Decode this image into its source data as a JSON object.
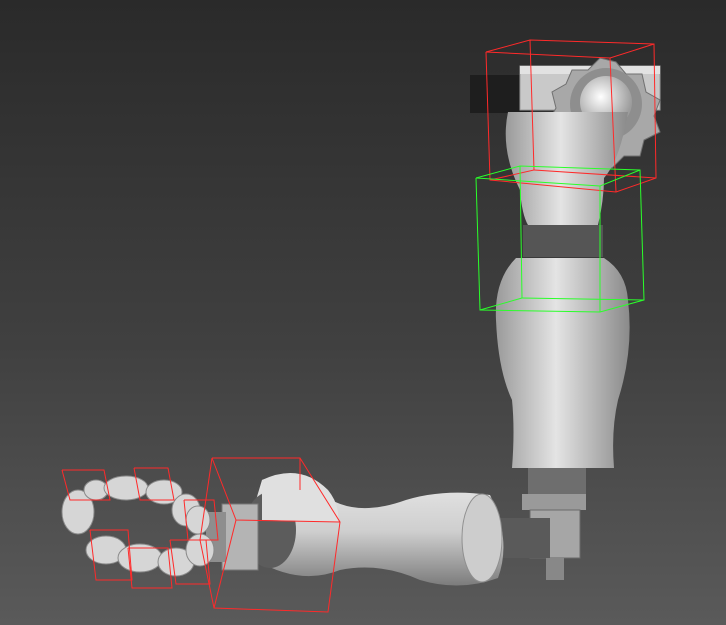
{
  "viewport": {
    "background_top": "#2a2a2a",
    "background_bottom": "#5a5a5a",
    "model_color": "#d8d8d8",
    "selected_bbox_color": "#ff2a2a",
    "active_bbox_color": "#2aff2a"
  },
  "scene": {
    "object": "robotic-arm-model",
    "parts": [
      "shoulder-gear",
      "upper-arm",
      "elbow-joint",
      "forearm",
      "wrist",
      "hand-fingers"
    ]
  }
}
